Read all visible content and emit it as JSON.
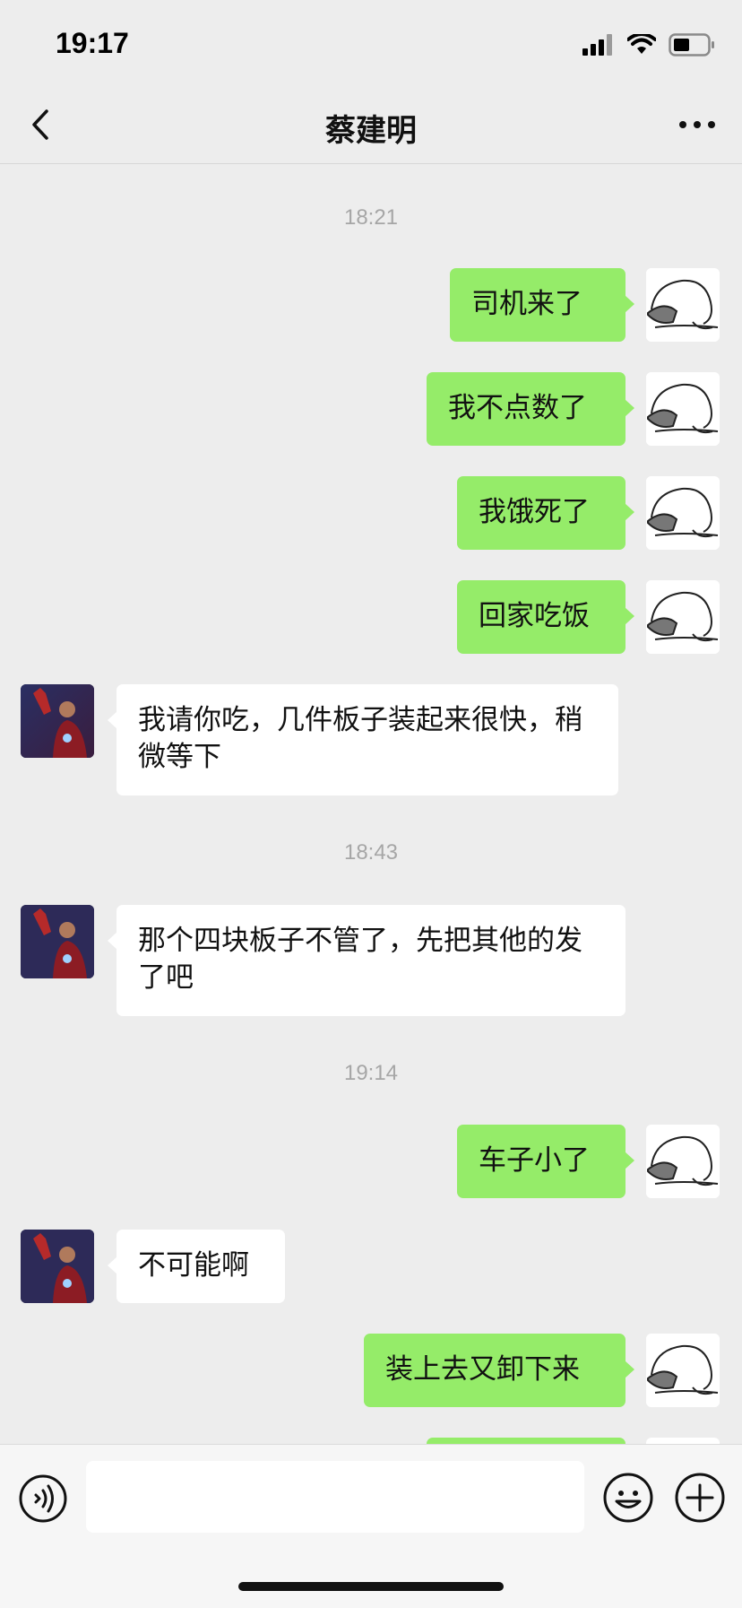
{
  "status_bar": {
    "time": "19:17",
    "signal_icon": "cellular-signal-icon",
    "wifi_icon": "wifi-icon",
    "battery_icon": "battery-icon"
  },
  "nav": {
    "title": "蔡建明",
    "back_icon": "chevron-left-icon",
    "more_icon": "more-dots-icon"
  },
  "messages": [
    {
      "type": "time",
      "text": "18:21"
    },
    {
      "type": "sent",
      "text": "司机来了"
    },
    {
      "type": "sent",
      "text": "我不点数了"
    },
    {
      "type": "sent",
      "text": "我饿死了"
    },
    {
      "type": "sent",
      "text": "回家吃饭"
    },
    {
      "type": "received",
      "text": "我请你吃，几件板子装起来很快，稍微等下"
    },
    {
      "type": "time",
      "text": "18:43"
    },
    {
      "type": "received",
      "text": "那个四块板子不管了，先把其他的发了吧"
    },
    {
      "type": "time",
      "text": "19:14"
    },
    {
      "type": "sent",
      "text": "车子小了"
    },
    {
      "type": "received",
      "text": "不可能啊"
    },
    {
      "type": "sent",
      "text": "装上去又卸下来"
    }
  ],
  "input": {
    "value": "",
    "voice_icon": "voice-icon",
    "emoji_icon": "emoji-icon",
    "plus_icon": "plus-icon"
  },
  "colors": {
    "background": "#ededed",
    "sent_bubble": "#95ec69",
    "received_bubble": "#ffffff",
    "timestamp_text": "#a6a6a6"
  }
}
